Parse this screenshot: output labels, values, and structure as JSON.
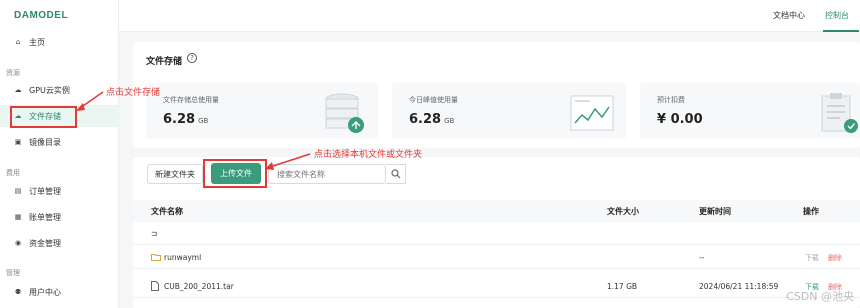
{
  "brand": {
    "logo": "DAMODEL",
    "accent": "#2f8a6a"
  },
  "sidebar": {
    "home": {
      "label": "主页",
      "icon": "home-icon"
    },
    "section_resources": "资源",
    "gpu": {
      "label": "GPU云实例",
      "icon": "cloud-icon"
    },
    "storage": {
      "label": "文件存储",
      "icon": "cloud-storage-icon"
    },
    "images": {
      "label": "镜像目录",
      "icon": "book-icon"
    },
    "section_billing": "费用",
    "orders": {
      "label": "订单管理",
      "icon": "order-icon"
    },
    "bills": {
      "label": "账单管理",
      "icon": "bill-icon"
    },
    "funds": {
      "label": "资金管理",
      "icon": "coin-icon"
    },
    "section_manage": "管理",
    "user": {
      "label": "用户中心",
      "icon": "user-icon"
    }
  },
  "topbar": {
    "docs": "文档中心",
    "console": "控制台"
  },
  "page": {
    "title": "文件存储"
  },
  "stats": [
    {
      "label": "文件存储总使用量",
      "value": "6.28",
      "unit": "GB"
    },
    {
      "label": "今日峰值使用量",
      "value": "6.28",
      "unit": "GB"
    },
    {
      "label": "预计扣费",
      "value": "¥ 0.00",
      "unit": ""
    }
  ],
  "toolbar": {
    "new_folder": "新建文件夹",
    "upload": "上传文件",
    "search_placeholder": "搜索文件名称"
  },
  "table": {
    "headers": {
      "name": "文件名称",
      "size": "文件大小",
      "time": "更新时间",
      "ops": "操作"
    },
    "parent": "⊐",
    "rows": [
      {
        "name": "runwayml",
        "size": "",
        "time": "--",
        "download": "下载",
        "delete": "删除"
      },
      {
        "name": "CUB_200_2011.tar",
        "size": "1.17 GB",
        "time": "2024/06/21 11:18:59",
        "download": "下载",
        "delete": "删除"
      }
    ]
  },
  "annotations": {
    "click_storage": "点击文件存储",
    "click_select": "点击选择本机文件或文件夹"
  },
  "watermark": "CSDN @池央"
}
